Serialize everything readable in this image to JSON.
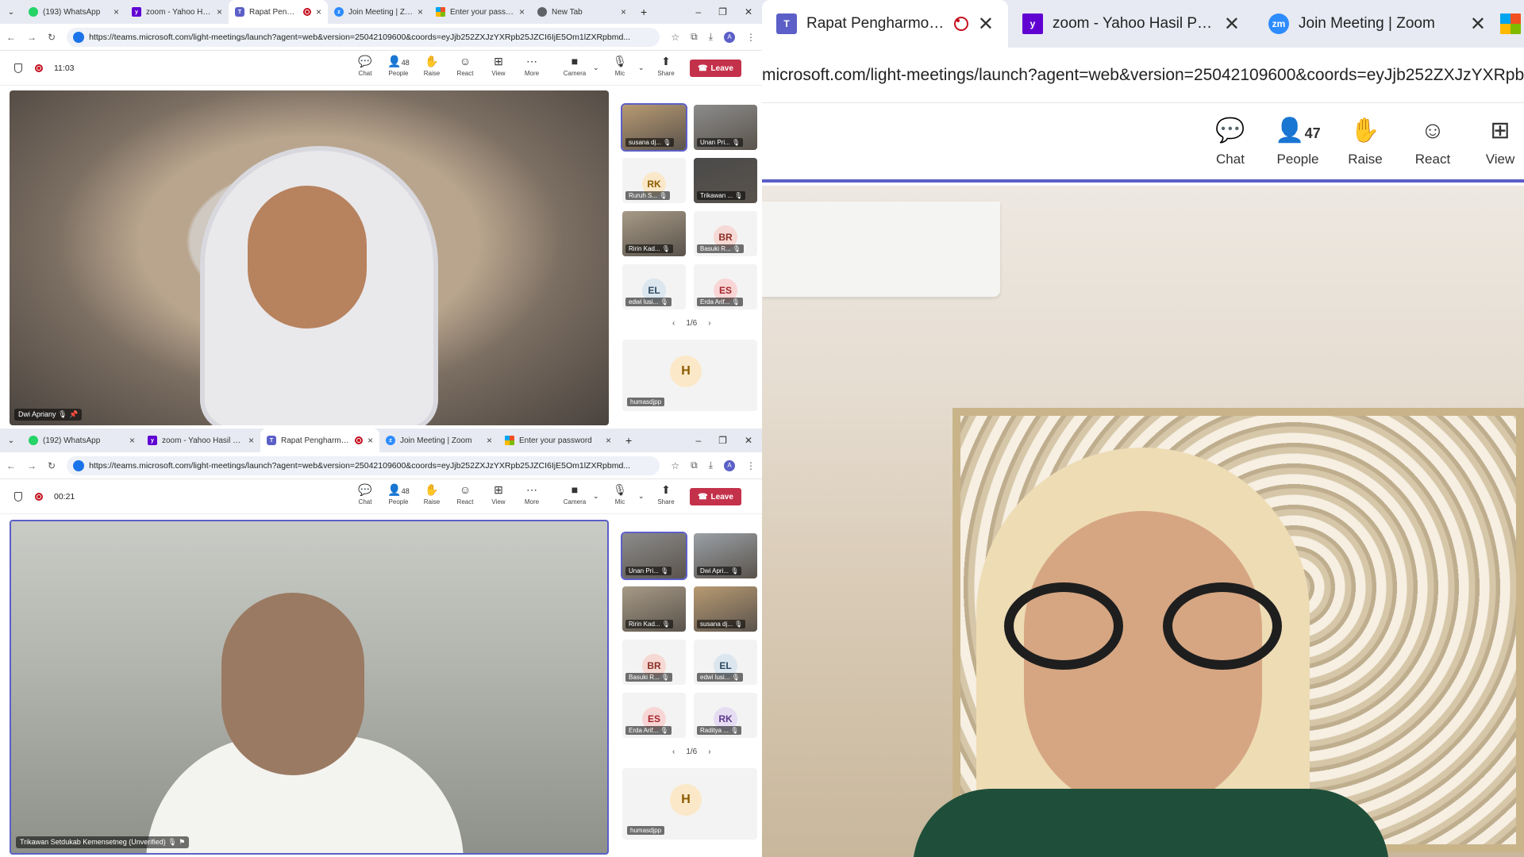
{
  "top": {
    "tabs": [
      {
        "label": "(193) WhatsApp",
        "fav": "wa"
      },
      {
        "label": "zoom - Yahoo Hasil Pencarian",
        "fav": "yh"
      },
      {
        "label": "Rapat Pengharmonisasian",
        "fav": "tm",
        "active": true,
        "recording": true
      },
      {
        "label": "Join Meeting | Zoom",
        "fav": "zm"
      },
      {
        "label": "Enter your password",
        "fav": "ms"
      },
      {
        "label": "New Tab",
        "fav": "gl"
      }
    ],
    "url": "https://teams.microsoft.com/light-meetings/launch?agent=web&version=25042109600&coords=eyJjb252ZXJzYXRpb25JZCI6IjE5Om1lZXRpbmd...",
    "avatar": "A",
    "timer": "11:03",
    "people_count": "48",
    "main_label": "Dwi Apriany",
    "tiles": [
      {
        "name": "susana dj...",
        "type": "photo",
        "bg": "#b89a72",
        "selected": true
      },
      {
        "name": "Unan Pri...",
        "type": "photo",
        "bg": "#8c8c8c"
      },
      {
        "name": "Ruruh S...",
        "type": "initials",
        "initials": "RK",
        "bg": "#fbe8c8",
        "fg": "#8a5a00"
      },
      {
        "name": "Trikawan ...",
        "type": "photo",
        "bg": "#4a4a4a"
      },
      {
        "name": "Ririn Kad...",
        "type": "photo",
        "bg": "#a79a86"
      },
      {
        "name": "Basuki R...",
        "type": "initials",
        "initials": "BR",
        "bg": "#f6d9d4",
        "fg": "#8a2d23"
      },
      {
        "name": "edwi lusi...",
        "type": "initials",
        "initials": "EL",
        "bg": "#dbe6ef",
        "fg": "#2e4a62"
      },
      {
        "name": "Erda Arif...",
        "type": "initials",
        "initials": "ES",
        "bg": "#f8d6d6",
        "fg": "#a4262c"
      }
    ],
    "page": "1/6",
    "big_tile": {
      "initials": "H",
      "name": "humasdjpp"
    }
  },
  "bottom": {
    "tabs": [
      {
        "label": "(192) WhatsApp",
        "fav": "wa"
      },
      {
        "label": "zoom - Yahoo Hasil Pencarian",
        "fav": "yh"
      },
      {
        "label": "Rapat Pengharmonisasian",
        "fav": "tm",
        "active": true,
        "recording": true
      },
      {
        "label": "Join Meeting | Zoom",
        "fav": "zm"
      },
      {
        "label": "Enter your password",
        "fav": "ms"
      }
    ],
    "url": "https://teams.microsoft.com/light-meetings/launch?agent=web&version=25042109600&coords=eyJjb252ZXJzYXRpb25JZCI6IjE5Om1lZXRpbmd...",
    "avatar": "A",
    "timer": "00:21",
    "people_count": "48",
    "main_label": "Trikawan Setdukab Kemensetneg (Unverified)",
    "tiles": [
      {
        "name": "Unan Pri...",
        "type": "photo",
        "bg": "#8c8c8c",
        "selected": true
      },
      {
        "name": "Dwi Apri...",
        "type": "photo",
        "bg": "#9aa0a6"
      },
      {
        "name": "Ririn Kad...",
        "type": "photo",
        "bg": "#a79a86"
      },
      {
        "name": "susana dj...",
        "type": "photo",
        "bg": "#b89a72"
      },
      {
        "name": "Basuki R...",
        "type": "initials",
        "initials": "BR",
        "bg": "#f6d9d4",
        "fg": "#8a2d23"
      },
      {
        "name": "edwi lusi...",
        "type": "initials",
        "initials": "EL",
        "bg": "#dbe6ef",
        "fg": "#2e4a62"
      },
      {
        "name": "Erda Arif...",
        "type": "initials",
        "initials": "ES",
        "bg": "#f8d6d6",
        "fg": "#a4262c"
      },
      {
        "name": "Raditya ...",
        "type": "initials",
        "initials": "RK",
        "bg": "#e6ddf3",
        "fg": "#5b3a8c"
      }
    ],
    "page": "1/6",
    "big_tile": {
      "initials": "H",
      "name": "humasdjpp"
    }
  },
  "toolbar": {
    "chat": "Chat",
    "people": "People",
    "raise": "Raise",
    "react": "React",
    "view": "View",
    "more": "More",
    "camera": "Camera",
    "mic": "Mic",
    "share": "Share",
    "leave": "Leave"
  },
  "right": {
    "tabs": [
      {
        "label": "Rapat Pengharmonisasian",
        "fav": "tm",
        "recording": true
      },
      {
        "label": "zoom - Yahoo Hasil Pencarian",
        "fav": "yh"
      },
      {
        "label": "Join Meeting | Zoom",
        "fav": "zm"
      }
    ],
    "url_fragment": "microsoft.com/light-meetings/launch?agent=web&version=25042109600&coords=eyJjb252ZXJzYXRpb25JZCI6",
    "people_count": "47"
  },
  "colors": {
    "teams_purple": "#5b5fc7",
    "leave_red": "#c4314b",
    "rec_red": "#c50f1f"
  }
}
